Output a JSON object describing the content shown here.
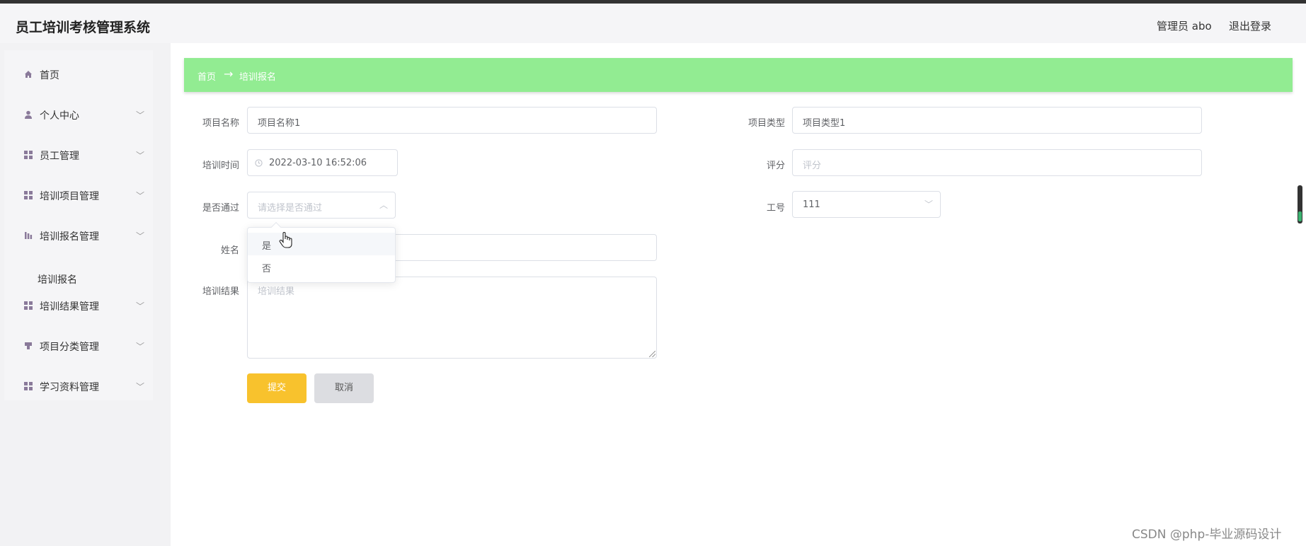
{
  "app": {
    "title": "员工培训考核管理系统",
    "admin_label": "管理员 abo",
    "logout_label": "退出登录"
  },
  "sidebar": {
    "items": [
      {
        "label": "首页",
        "icon": "home-icon"
      },
      {
        "label": "个人中心",
        "icon": "user-icon"
      },
      {
        "label": "员工管理",
        "icon": "grid-icon"
      },
      {
        "label": "培训项目管理",
        "icon": "grid-icon"
      },
      {
        "label": "培训报名管理",
        "icon": "bars-icon"
      },
      {
        "label": "培训结果管理",
        "icon": "grid-icon"
      },
      {
        "label": "项目分类管理",
        "icon": "tag-icon"
      },
      {
        "label": "学习资料管理",
        "icon": "grid-icon"
      }
    ],
    "sub_item": "培训报名"
  },
  "breadcrumb": {
    "home": "首页",
    "separator": "→",
    "current": "培训报名"
  },
  "form": {
    "project_name": {
      "label": "项目名称",
      "value": "项目名称1"
    },
    "project_type": {
      "label": "项目类型",
      "value": "项目类型1"
    },
    "training_time": {
      "label": "培训时间",
      "value": "2022-03-10 16:52:06"
    },
    "score": {
      "label": "评分",
      "placeholder": "评分"
    },
    "passed": {
      "label": "是否通过",
      "placeholder": "请选择是否通过",
      "options": [
        "是",
        "否"
      ]
    },
    "employee_no": {
      "label": "工号",
      "value": "111"
    },
    "name": {
      "label": "姓名"
    },
    "result": {
      "label": "培训结果",
      "placeholder": "培训结果"
    },
    "submit_label": "提交",
    "cancel_label": "取消"
  },
  "colors": {
    "breadcrumb_bg": "#92ec92",
    "submit_bg": "#f8c22d",
    "cancel_bg": "#dcdde1"
  },
  "watermark": "CSDN @php-毕业源码设计"
}
